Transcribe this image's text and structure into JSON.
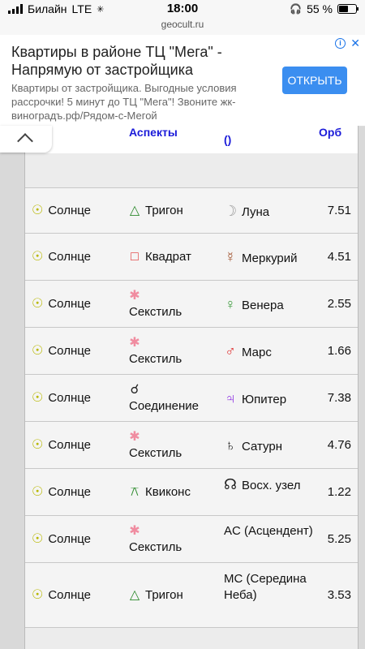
{
  "status": {
    "carrier": "Билайн",
    "network": "LTE",
    "time": "18:00",
    "url": "geocult.ru",
    "battery": "55 %",
    "battery_level": 0.55
  },
  "ad": {
    "title": "Квартиры в районе ТЦ \"Мега\" - Напрямую от застройщика",
    "description": "Квартиры от застройщика. Выгодные условия рассрочки! 5 минут до ТЦ \"Мега\"! Звоните жк-виноградъ.рф/Рядом-с-Мегой",
    "button": "ОТКРЫТЬ",
    "info_icon": "i",
    "close_icon": "✕"
  },
  "table": {
    "headers": {
      "aspects": "Аспекты",
      "paren": "()",
      "orb": "Орб"
    },
    "rows": [
      {
        "planet": "Солнце",
        "planet_symbol": "☉",
        "aspect": "Тригон",
        "aspect_symbol": "△",
        "aspect_color": "#2e8b2e",
        "target": "Луна",
        "target_symbol": "☽",
        "target_color": "#999999",
        "orb": "7.51"
      },
      {
        "planet": "Солнце",
        "planet_symbol": "☉",
        "aspect": "Квадрат",
        "aspect_symbol": "□",
        "aspect_color": "#e03030",
        "target": "Меркурий",
        "target_symbol": "☿",
        "target_color": "#a0522d",
        "orb": "4.51"
      },
      {
        "planet": "Солнце",
        "planet_symbol": "☉",
        "aspect": "Секстиль",
        "aspect_symbol": "✱",
        "aspect_color": "#f08ca0",
        "target": "Венера",
        "target_symbol": "♀",
        "target_color": "#3a9a3a",
        "orb": "2.55"
      },
      {
        "planet": "Солнце",
        "planet_symbol": "☉",
        "aspect": "Секстиль",
        "aspect_symbol": "✱",
        "aspect_color": "#f08ca0",
        "target": "Марс",
        "target_symbol": "♂",
        "target_color": "#e03030",
        "orb": "1.66"
      },
      {
        "planet": "Солнце",
        "planet_symbol": "☉",
        "aspect": "Соединение",
        "aspect_symbol": "☌",
        "aspect_color": "#222222",
        "target": "Юпитер",
        "target_symbol": "♃",
        "target_color": "#8a2be2",
        "orb": "7.38"
      },
      {
        "planet": "Солнце",
        "planet_symbol": "☉",
        "aspect": "Секстиль",
        "aspect_symbol": "✱",
        "aspect_color": "#f08ca0",
        "target": "Сатурн",
        "target_symbol": "♄",
        "target_color": "#222222",
        "orb": "4.76"
      },
      {
        "planet": "Солнце",
        "planet_symbol": "☉",
        "aspect": "Квиконс",
        "aspect_symbol": "⚻",
        "aspect_color": "#2e8b2e",
        "target": "Восх. узел",
        "target_symbol": "☊",
        "target_color": "#222222",
        "orb": "1.22"
      },
      {
        "planet": "Солнце",
        "planet_symbol": "☉",
        "aspect": "Секстиль",
        "aspect_symbol": "✱",
        "aspect_color": "#f08ca0",
        "target": "AC (Асцендент)",
        "target_symbol": "",
        "target_color": "#222222",
        "orb": "5.25"
      },
      {
        "planet": "Солнце",
        "planet_symbol": "☉",
        "aspect": "Тригон",
        "aspect_symbol": "△",
        "aspect_color": "#2e8b2e",
        "target": "MC (Середина Неба)",
        "target_symbol": "",
        "target_color": "#222222",
        "orb": "3.53"
      }
    ]
  }
}
